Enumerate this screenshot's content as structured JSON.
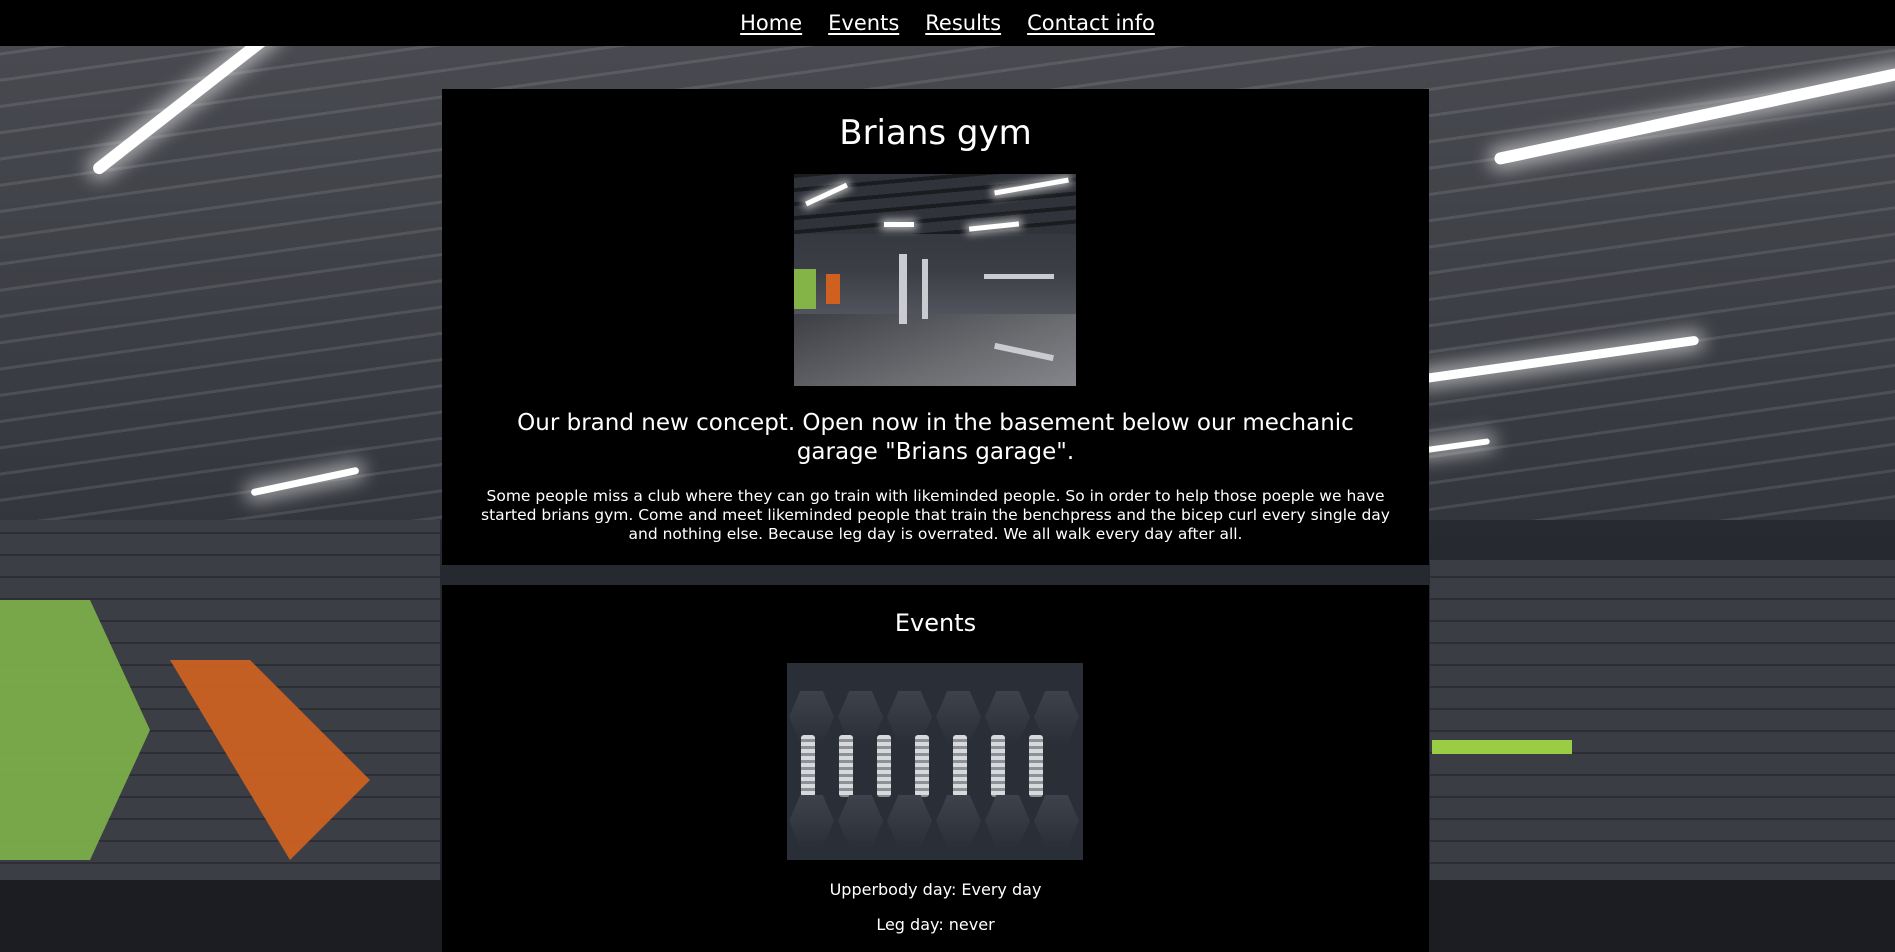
{
  "nav": {
    "links": [
      "Home",
      "Events",
      "Results",
      "Contact info"
    ]
  },
  "intro": {
    "title": "Brians gym",
    "tagline": "Our brand new concept. Open now in the basement below our mechanic garage \"Brians garage\".",
    "body": "Some people miss a club where they can go train with likeminded people. So in order to help those poeple we have started brians gym. Come and meet likeminded people that train the benchpress and the bicep curl every single day and nothing else. Because leg day is overrated. We all walk every day after all."
  },
  "events": {
    "title": "Events",
    "items": [
      "Upperbody day: Every day",
      "Leg day: never"
    ]
  },
  "colors": {
    "nav_background": "#000000",
    "panel_background": "#000000",
    "text": "#ffffff"
  }
}
